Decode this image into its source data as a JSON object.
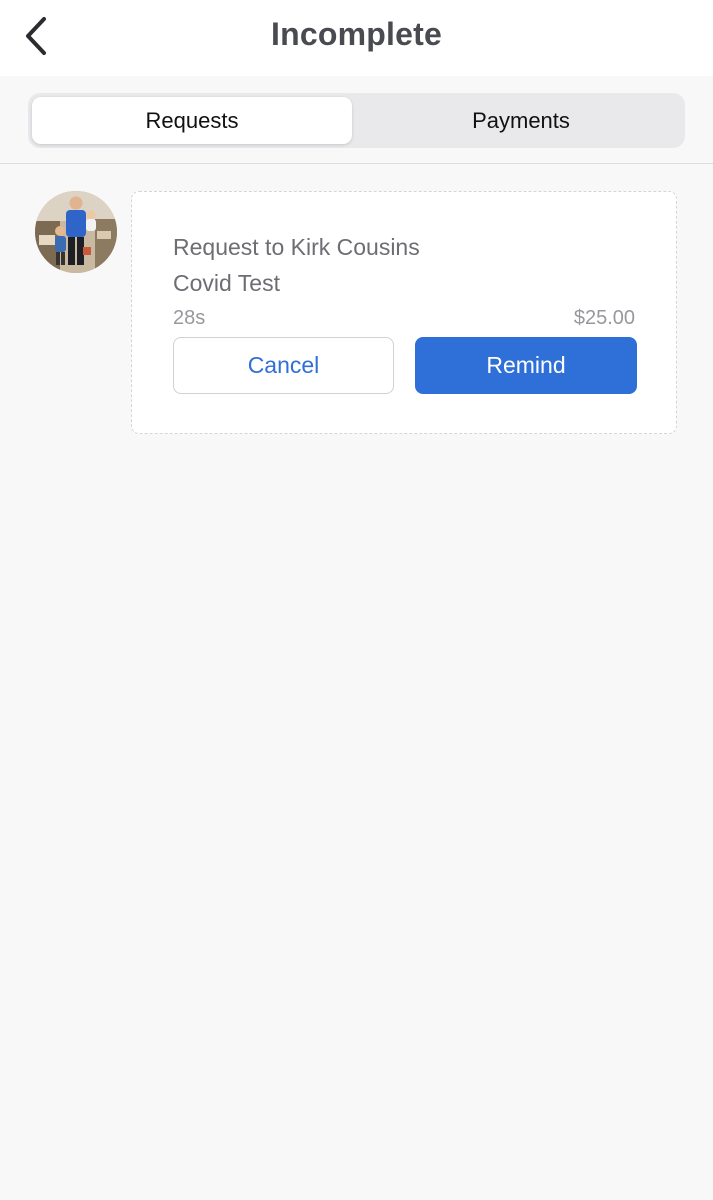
{
  "header": {
    "title": "Incomplete",
    "back_icon": "chevron-left-icon"
  },
  "tabs": [
    {
      "label": "Requests",
      "active": true
    },
    {
      "label": "Payments",
      "active": false
    }
  ],
  "request": {
    "title": "Request to Kirk Cousins",
    "description": "Covid Test",
    "time": "28s",
    "amount": "$25.00",
    "cancel_label": "Cancel",
    "remind_label": "Remind"
  },
  "colors": {
    "accent": "#2e6fd8",
    "title_text": "#4a4b50",
    "secondary_text": "#6d6e74",
    "muted_text": "#97989d",
    "background": "#f8f8f9"
  }
}
